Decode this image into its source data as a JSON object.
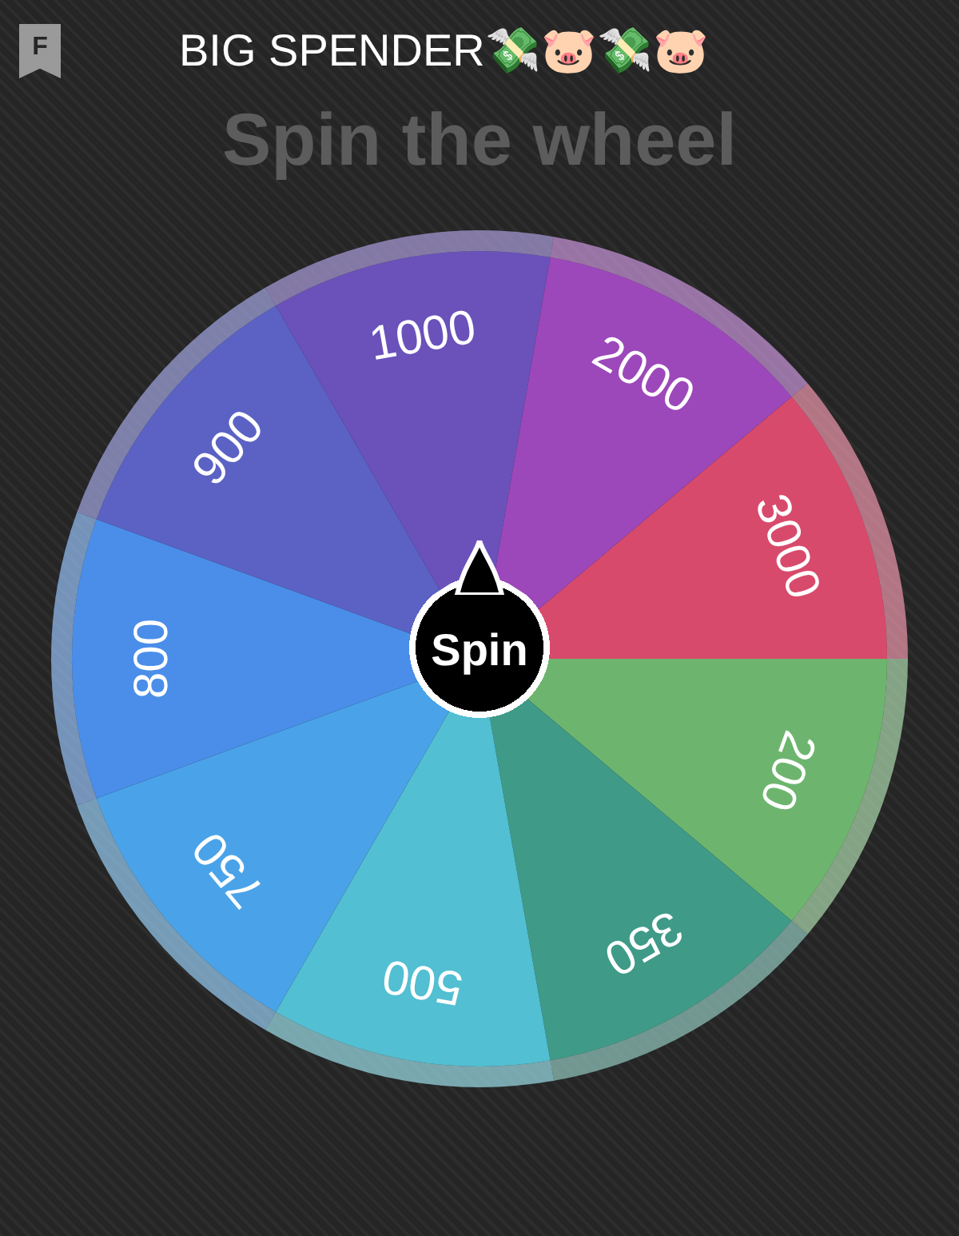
{
  "header": {
    "badge": "F",
    "title": "BIG SPENDER💸🐷💸🐷"
  },
  "heading": "Spin the wheel",
  "wheel": {
    "segments": [
      {
        "label": "3000",
        "color": "#d84a6c"
      },
      {
        "label": "200",
        "color": "#6db56e"
      },
      {
        "label": "350",
        "color": "#3f9a88"
      },
      {
        "label": "500",
        "color": "#52bfd2"
      },
      {
        "label": "750",
        "color": "#4aa3e8"
      },
      {
        "label": "800",
        "color": "#4a8ee9"
      },
      {
        "label": "900",
        "color": "#5b62c4"
      },
      {
        "label": "1000",
        "color": "#6a52ba"
      },
      {
        "label": "2000",
        "color": "#9c48ba"
      }
    ],
    "spin_button": "Spin"
  }
}
